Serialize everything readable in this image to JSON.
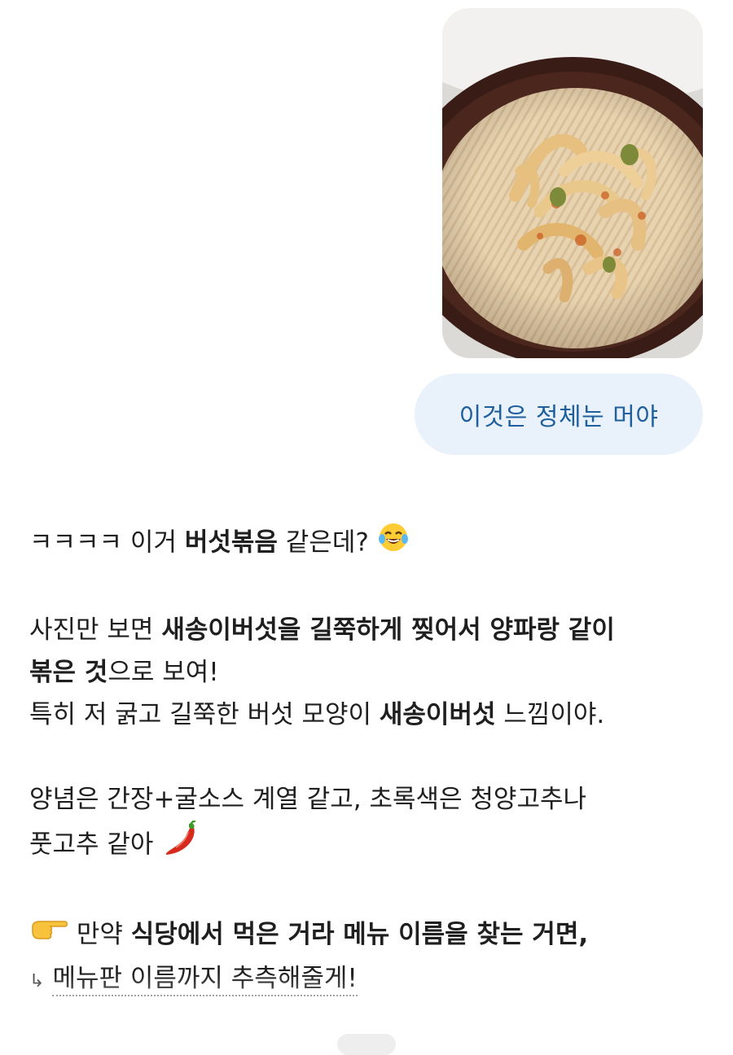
{
  "user_message": {
    "photo_icon": "mushroom-dish-photo",
    "text": "이것은 정체눈 머야"
  },
  "assistant_reply": {
    "line1": {
      "pre": "ㅋㅋㅋㅋ 이거 ",
      "bold": "버섯볶음",
      "post": " 같은데?",
      "emoji": "laughing-tears-emoji"
    },
    "line2": {
      "pre": "사진만 보면 ",
      "bold": "새송이버섯을 길쭉하게 찢어서 양파랑 같이"
    },
    "line3": {
      "bold": "볶은 것",
      "post": "으로 보여!"
    },
    "line4": {
      "pre": "특히 저 굵고 길쭉한 버섯 모양이 ",
      "bold": "새송이버섯",
      "post": " 느낌이야."
    },
    "line5": {
      "text": "양념은 간장+굴소스 계열 같고, 초록색은 청양고추나"
    },
    "line6": {
      "text": "풋고추 같아",
      "emoji": "chili-pepper-emoji"
    },
    "line7": {
      "emoji": "pointing-hand-emoji",
      "pre": " 만약 ",
      "bold": "식당에서 먹은 거라 메뉴 이름을 찾는 거면,"
    },
    "line8": {
      "arrow": "↳",
      "text": "메뉴판 이름까지 추측해줄게!"
    }
  }
}
